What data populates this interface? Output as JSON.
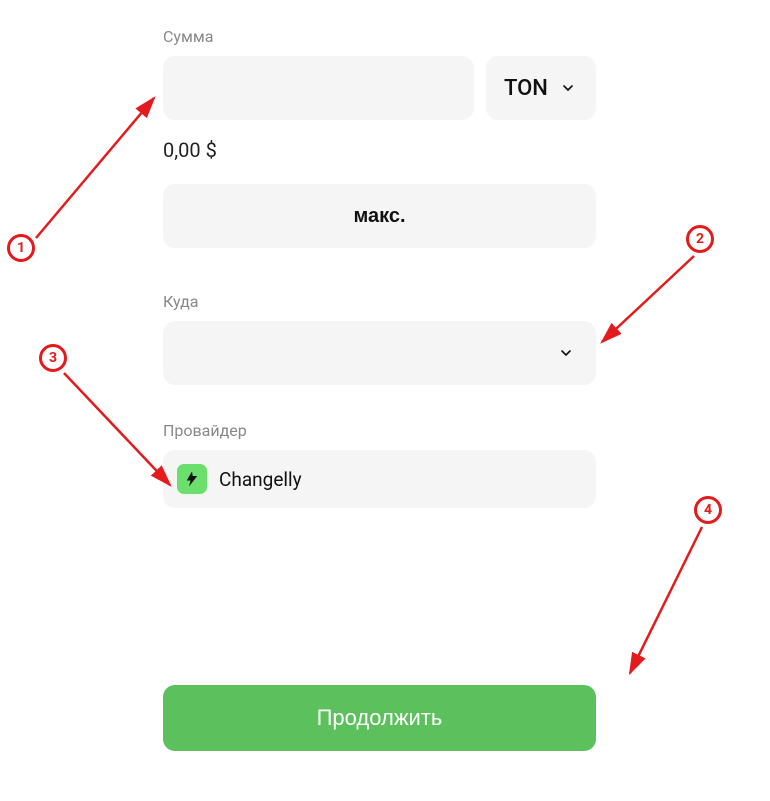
{
  "labels": {
    "amount": "Сумма",
    "destination": "Куда",
    "provider": "Провайдер"
  },
  "currency": {
    "selected": "TON"
  },
  "fiat_value": "0,00 $",
  "buttons": {
    "max": "макс.",
    "continue": "Продолжить"
  },
  "provider": {
    "name": "Changelly"
  },
  "annotations": {
    "1": "1",
    "2": "2",
    "3": "3",
    "4": "4"
  }
}
